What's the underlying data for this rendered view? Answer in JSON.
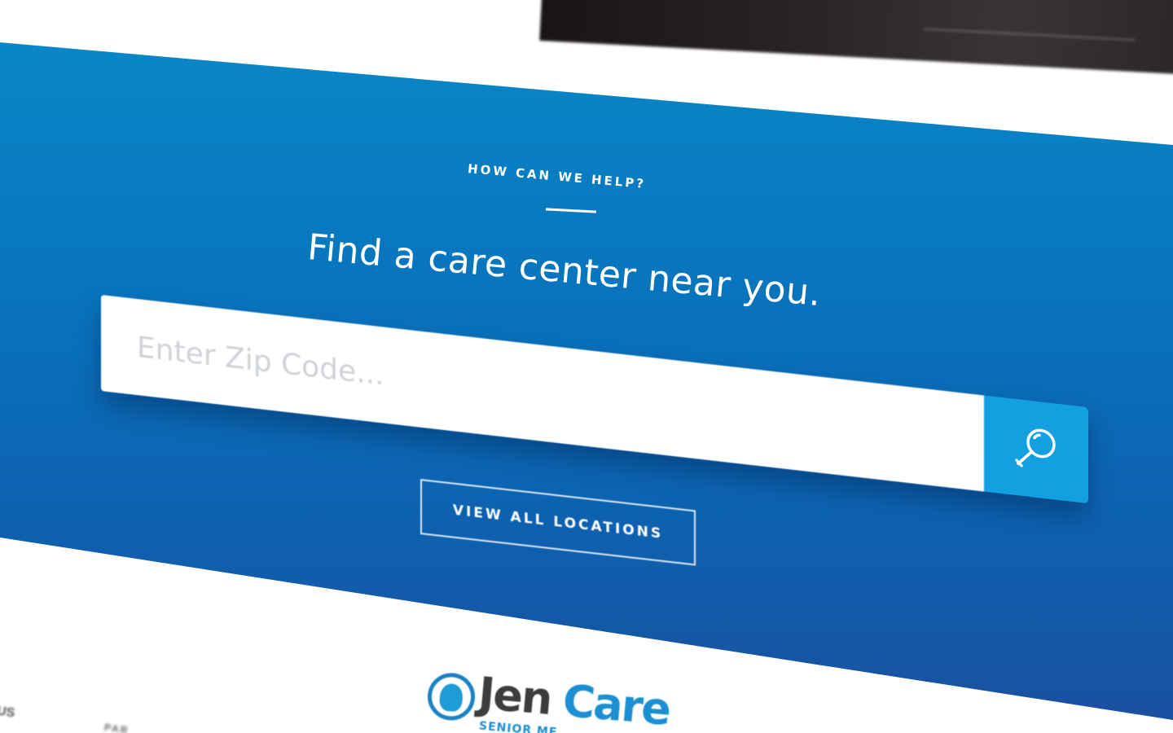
{
  "colors": {
    "band_top": "#0a8ac8",
    "band_bottom": "#1b4fa0",
    "search_button": "#12a0e0",
    "logo_blue": "#1b8fd2",
    "logo_dark": "#3d3d3d"
  },
  "finder": {
    "eyebrow": "HOW CAN WE HELP?",
    "headline": "Find a care center near you.",
    "zip_placeholder": "Enter Zip Code...",
    "zip_value": "",
    "search_icon": "search-icon",
    "view_all_label": "VIEW ALL LOCATIONS"
  },
  "footer": {
    "left_text": "US",
    "mid_text": "PAR",
    "logo": {
      "brand_first": "Jen",
      "brand_second": "Care",
      "tagline": "SENIOR ME"
    }
  }
}
